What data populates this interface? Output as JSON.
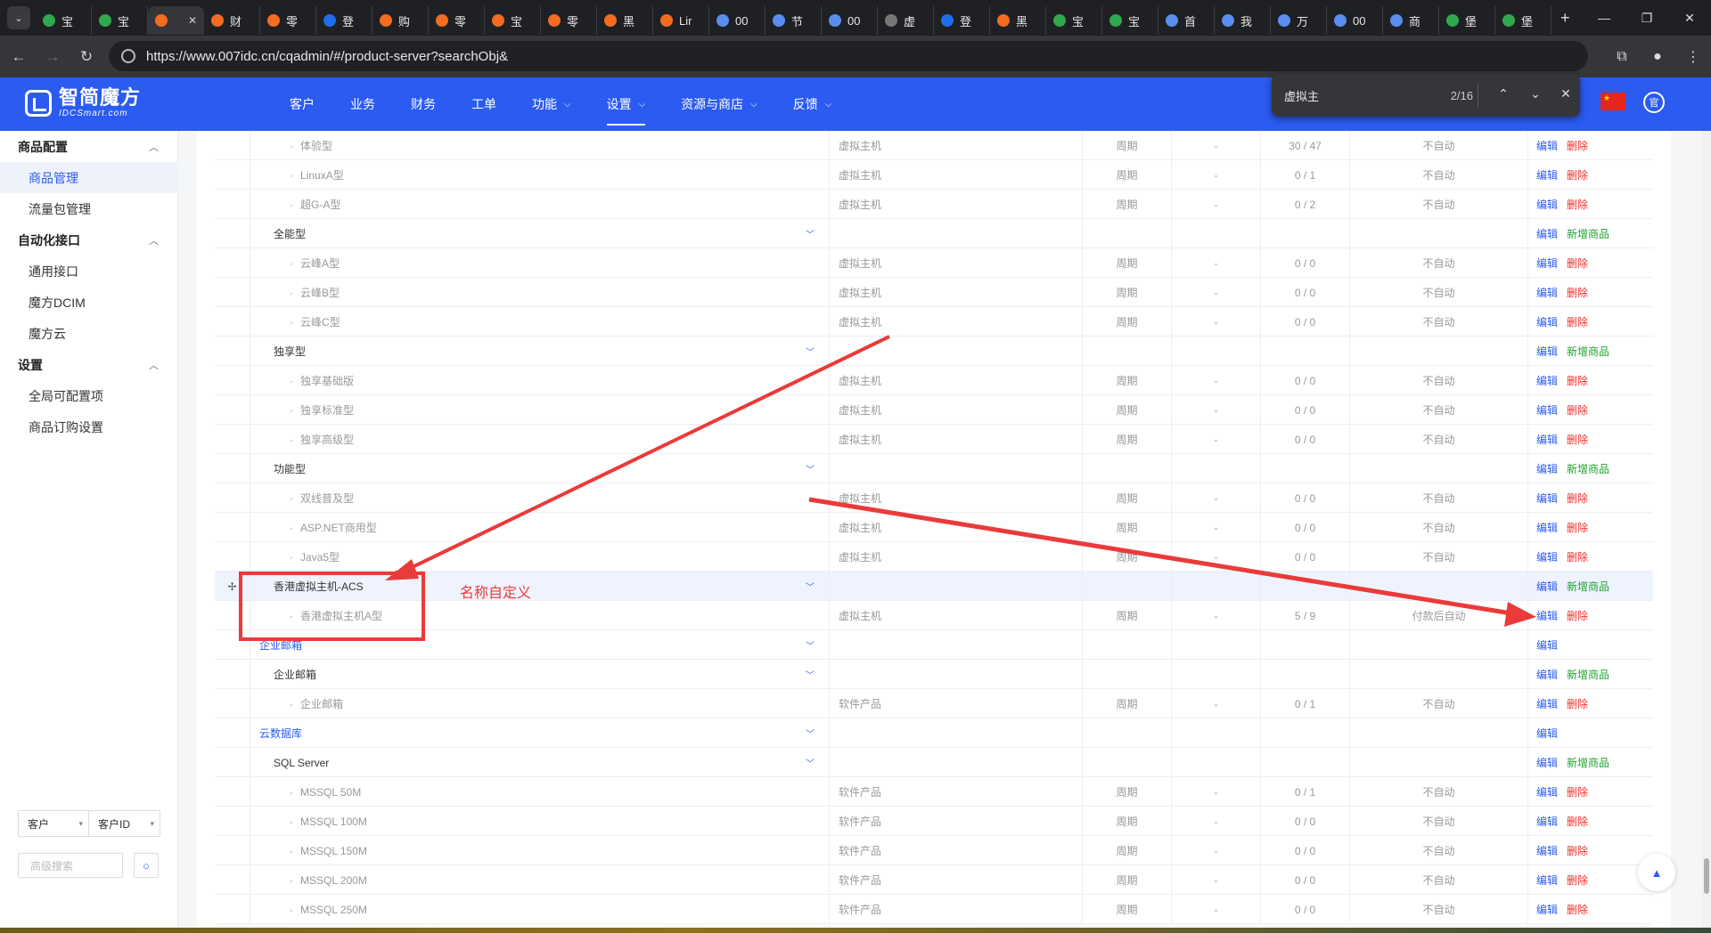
{
  "browser": {
    "tabs": [
      {
        "label": "宝",
        "color": "#2fa84f"
      },
      {
        "label": "宝",
        "color": "#2fa84f"
      },
      {
        "label": "",
        "color": "#f26c22",
        "active": true,
        "close": "✕"
      },
      {
        "label": "财",
        "color": "#f26c22"
      },
      {
        "label": "零",
        "color": "#f26c22"
      },
      {
        "label": "登",
        "color": "#1f6feb"
      },
      {
        "label": "购",
        "color": "#f26c22"
      },
      {
        "label": "零",
        "color": "#f26c22"
      },
      {
        "label": "宝",
        "color": "#f26c22"
      },
      {
        "label": "零",
        "color": "#f26c22"
      },
      {
        "label": "黑",
        "color": "#f26c22"
      },
      {
        "label": "Lir",
        "color": "#f26c22"
      },
      {
        "label": "00",
        "color": "#5b8def"
      },
      {
        "label": "节",
        "color": "#5b8def"
      },
      {
        "label": "00",
        "color": "#5b8def"
      },
      {
        "label": "虚",
        "color": "#777777"
      },
      {
        "label": "登",
        "color": "#1f6feb"
      },
      {
        "label": "黑",
        "color": "#f26c22"
      },
      {
        "label": "宝",
        "color": "#2fa84f"
      },
      {
        "label": "宝",
        "color": "#2fa84f"
      },
      {
        "label": "首",
        "color": "#5b8def"
      },
      {
        "label": "我",
        "color": "#5b8def"
      },
      {
        "label": "万",
        "color": "#5b8def"
      },
      {
        "label": "00",
        "color": "#5b8def"
      },
      {
        "label": "商",
        "color": "#5b8def"
      },
      {
        "label": "堡",
        "color": "#2fa84f"
      },
      {
        "label": "堡",
        "color": "#2fa84f"
      }
    ],
    "url": "https://www.007idc.cn/cqadmin/#/product-server?searchObj&"
  },
  "find": {
    "query": "虚拟主",
    "count": "2/16",
    "up": "⌃",
    "down": "⌄",
    "close": "✕"
  },
  "header": {
    "logo_cn": "智简魔方",
    "logo_en": "IDCSmart.com",
    "nav": [
      {
        "label": "客户",
        "caret": false,
        "active": false
      },
      {
        "label": "业务",
        "caret": false,
        "active": false
      },
      {
        "label": "财务",
        "caret": false,
        "active": false
      },
      {
        "label": "工单",
        "caret": false,
        "active": false
      },
      {
        "label": "功能",
        "caret": true,
        "active": false
      },
      {
        "label": "设置",
        "caret": true,
        "active": true
      },
      {
        "label": "资源与商店",
        "caret": true,
        "active": false
      },
      {
        "label": "反馈",
        "caret": true,
        "active": false
      }
    ],
    "user_icon": "官"
  },
  "sidebar": {
    "groups": [
      {
        "label": "商品配置",
        "items": [
          {
            "label": "商品管理",
            "active": true
          },
          {
            "label": "流量包管理"
          }
        ]
      },
      {
        "label": "自动化接口",
        "items": [
          {
            "label": "通用接口"
          },
          {
            "label": "魔方DCIM"
          },
          {
            "label": "魔方云"
          }
        ]
      },
      {
        "label": "设置",
        "items": [
          {
            "label": "全局可配置项"
          },
          {
            "label": "商品订购设置"
          }
        ]
      }
    ],
    "filter_left": "客户",
    "filter_right": "客户ID",
    "search_placeholder": "高级搜索"
  },
  "ops": {
    "edit": "编辑",
    "delete": "删除",
    "add": "新增商品"
  },
  "rows": [
    {
      "level": 3,
      "name": "体验型",
      "type": "虚拟主机",
      "cycle": "周期",
      "dash": "-",
      "stock": "30 / 47",
      "auto": "不自动",
      "ops": [
        "edit",
        "delete"
      ]
    },
    {
      "level": 3,
      "name": "LinuxA型",
      "type": "虚拟主机",
      "cycle": "周期",
      "dash": "-",
      "stock": "0 / 1",
      "auto": "不自动",
      "ops": [
        "edit",
        "delete"
      ]
    },
    {
      "level": 3,
      "name": "超G-A型",
      "type": "虚拟主机",
      "cycle": "周期",
      "dash": "-",
      "stock": "0 / 2",
      "auto": "不自动",
      "ops": [
        "edit",
        "delete"
      ]
    },
    {
      "level": 2,
      "name": "全能型",
      "ops": [
        "edit",
        "add"
      ]
    },
    {
      "level": 3,
      "name": "云峰A型",
      "type": "虚拟主机",
      "cycle": "周期",
      "dash": "-",
      "stock": "0 / 0",
      "auto": "不自动",
      "ops": [
        "edit",
        "delete"
      ]
    },
    {
      "level": 3,
      "name": "云峰B型",
      "type": "虚拟主机",
      "cycle": "周期",
      "dash": "-",
      "stock": "0 / 0",
      "auto": "不自动",
      "ops": [
        "edit",
        "delete"
      ]
    },
    {
      "level": 3,
      "name": "云峰C型",
      "type": "虚拟主机",
      "cycle": "周期",
      "dash": "-",
      "stock": "0 / 0",
      "auto": "不自动",
      "ops": [
        "edit",
        "delete"
      ]
    },
    {
      "level": 2,
      "name": "独享型",
      "ops": [
        "edit",
        "add"
      ]
    },
    {
      "level": 3,
      "name": "独享基础版",
      "type": "虚拟主机",
      "cycle": "周期",
      "dash": "-",
      "stock": "0 / 0",
      "auto": "不自动",
      "ops": [
        "edit",
        "delete"
      ]
    },
    {
      "level": 3,
      "name": "独享标准型",
      "type": "虚拟主机",
      "cycle": "周期",
      "dash": "-",
      "stock": "0 / 0",
      "auto": "不自动",
      "ops": [
        "edit",
        "delete"
      ]
    },
    {
      "level": 3,
      "name": "独享高级型",
      "type": "虚拟主机",
      "cycle": "周期",
      "dash": "-",
      "stock": "0 / 0",
      "auto": "不自动",
      "ops": [
        "edit",
        "delete"
      ]
    },
    {
      "level": 2,
      "name": "功能型",
      "ops": [
        "edit",
        "add"
      ]
    },
    {
      "level": 3,
      "name": "双线普及型",
      "type": "虚拟主机",
      "cycle": "周期",
      "dash": "-",
      "stock": "0 / 0",
      "auto": "不自动",
      "ops": [
        "edit",
        "delete"
      ]
    },
    {
      "level": 3,
      "name": "ASP.NET商用型",
      "type": "虚拟主机",
      "cycle": "周期",
      "dash": "-",
      "stock": "0 / 0",
      "auto": "不自动",
      "ops": [
        "edit",
        "delete"
      ]
    },
    {
      "level": 3,
      "name": "Java5型",
      "type": "虚拟主机",
      "cycle": "周期",
      "dash": "-",
      "stock": "0 / 0",
      "auto": "不自动",
      "ops": [
        "edit",
        "delete"
      ]
    },
    {
      "level": 2,
      "name": "香港虚拟主机-ACS",
      "ops": [
        "edit",
        "add"
      ],
      "highlight": true,
      "drag": "✢"
    },
    {
      "level": 3,
      "name": "香港虚拟主机A型",
      "type": "虚拟主机",
      "cycle": "周期",
      "dash": "-",
      "stock": "5 / 9",
      "auto": "付款后自动",
      "ops": [
        "edit",
        "delete"
      ]
    },
    {
      "level": 1,
      "name": "企业邮箱",
      "ops": [
        "edit"
      ]
    },
    {
      "level": 2,
      "name": "企业邮箱",
      "ops": [
        "edit",
        "add"
      ]
    },
    {
      "level": 3,
      "name": "企业邮箱",
      "type": "软件产品",
      "cycle": "周期",
      "dash": "-",
      "stock": "0 / 1",
      "auto": "不自动",
      "ops": [
        "edit",
        "delete"
      ]
    },
    {
      "level": 1,
      "name": "云数据库",
      "ops": [
        "edit"
      ]
    },
    {
      "level": 2,
      "name": "SQL Server",
      "ops": [
        "edit",
        "add"
      ]
    },
    {
      "level": 3,
      "name": "MSSQL 50M",
      "type": "软件产品",
      "cycle": "周期",
      "dash": "-",
      "stock": "0 / 1",
      "auto": "不自动",
      "ops": [
        "edit",
        "delete"
      ]
    },
    {
      "level": 3,
      "name": "MSSQL 100M",
      "type": "软件产品",
      "cycle": "周期",
      "dash": "-",
      "stock": "0 / 0",
      "auto": "不自动",
      "ops": [
        "edit",
        "delete"
      ]
    },
    {
      "level": 3,
      "name": "MSSQL 150M",
      "type": "软件产品",
      "cycle": "周期",
      "dash": "-",
      "stock": "0 / 0",
      "auto": "不自动",
      "ops": [
        "edit",
        "delete"
      ]
    },
    {
      "level": 3,
      "name": "MSSQL 200M",
      "type": "软件产品",
      "cycle": "周期",
      "dash": "-",
      "stock": "0 / 0",
      "auto": "不自动",
      "ops": [
        "edit",
        "delete"
      ]
    },
    {
      "level": 3,
      "name": "MSSQL 250M",
      "type": "软件产品",
      "cycle": "周期",
      "dash": "-",
      "stock": "0 / 0",
      "auto": "不自动",
      "ops": [
        "edit",
        "delete"
      ]
    }
  ],
  "annotation": {
    "label": "名称自定义",
    "color": "#ea3a3a"
  },
  "colors": {
    "brand": "#2b5bf0",
    "danger": "#f0302e",
    "success": "#1fa22e"
  }
}
